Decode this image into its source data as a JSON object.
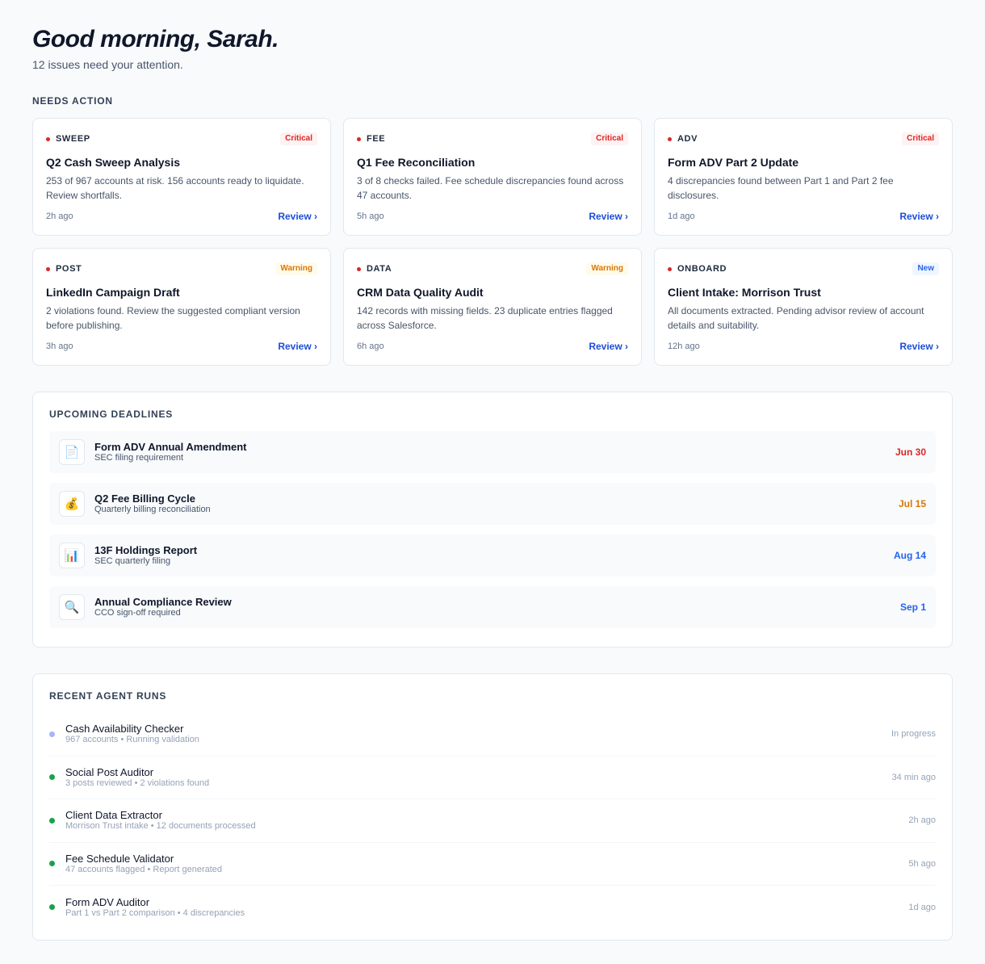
{
  "header": {
    "greeting": "Good morning, Sarah.",
    "subtitle": "12 issues need your attention."
  },
  "needs_action": {
    "label": "NEEDS ACTION",
    "cards": [
      {
        "category": "SWEEP",
        "badge": "Critical",
        "badge_type": "critical",
        "title": "Q2 Cash Sweep Analysis",
        "description": "253 of 967 accounts at risk. 156 accounts ready to liquidate. Review shortfalls.",
        "time": "2h ago",
        "action": "Review ›"
      },
      {
        "category": "FEE",
        "badge": "Critical",
        "badge_type": "critical",
        "title": "Q1 Fee Reconciliation",
        "description": "3 of 8 checks failed. Fee schedule discrepancies found across 47 accounts.",
        "time": "5h ago",
        "action": "Review ›"
      },
      {
        "category": "ADV",
        "badge": "Critical",
        "badge_type": "critical",
        "title": "Form ADV Part 2 Update",
        "description": "4 discrepancies found between Part 1 and Part 2 fee disclosures.",
        "time": "1d ago",
        "action": "Review ›"
      },
      {
        "category": "POST",
        "badge": "Warning",
        "badge_type": "warning",
        "title": "LinkedIn Campaign Draft",
        "description": "2 violations found. Review the suggested compliant version before publishing.",
        "time": "3h ago",
        "action": "Review ›"
      },
      {
        "category": "DATA",
        "badge": "Warning",
        "badge_type": "warning",
        "title": "CRM Data Quality Audit",
        "description": "142 records with missing fields. 23 duplicate entries flagged across Salesforce.",
        "time": "6h ago",
        "action": "Review ›"
      },
      {
        "category": "ONBOARD",
        "badge": "New",
        "badge_type": "new",
        "title": "Client Intake: Morrison Trust",
        "description": "All documents extracted. Pending advisor review of account details and suitability.",
        "time": "12h ago",
        "action": "Review ›"
      }
    ]
  },
  "deadlines": {
    "label": "UPCOMING DEADLINES",
    "items": [
      {
        "icon": "📄",
        "icon_name": "document-icon",
        "title": "Form ADV Annual Amendment",
        "subtitle": "SEC filing requirement",
        "date": "Jun 30",
        "color": "#dc2626"
      },
      {
        "icon": "💰",
        "icon_name": "money-bag-icon",
        "title": "Q2 Fee Billing Cycle",
        "subtitle": "Quarterly billing reconciliation",
        "date": "Jul 15",
        "color": "#d97706"
      },
      {
        "icon": "📊",
        "icon_name": "bar-chart-icon",
        "title": "13F Holdings Report",
        "subtitle": "SEC quarterly filing",
        "date": "Aug 14",
        "color": "#2563eb"
      },
      {
        "icon": "🔍",
        "icon_name": "magnifier-icon",
        "title": "Annual Compliance Review",
        "subtitle": "CCO sign-off required",
        "date": "Sep 1",
        "color": "#2563eb"
      }
    ]
  },
  "agent_runs": {
    "label": "RECENT AGENT RUNS",
    "items": [
      {
        "title": "Cash Availability Checker",
        "subtitle": "967 accounts • Running validation",
        "time": "In progress",
        "status_color": "#a5b4fc"
      },
      {
        "title": "Social Post Auditor",
        "subtitle": "3 posts reviewed • 2 violations found",
        "time": "34 min ago",
        "status_color": "#16a34a"
      },
      {
        "title": "Client Data Extractor",
        "subtitle": "Morrison Trust intake • 12 documents processed",
        "time": "2h ago",
        "status_color": "#16a34a"
      },
      {
        "title": "Fee Schedule Validator",
        "subtitle": "47 accounts flagged • Report generated",
        "time": "5h ago",
        "status_color": "#16a34a"
      },
      {
        "title": "Form ADV Auditor",
        "subtitle": "Part 1 vs Part 2 comparison • 4 discrepancies",
        "time": "1d ago",
        "status_color": "#16a34a"
      }
    ]
  }
}
